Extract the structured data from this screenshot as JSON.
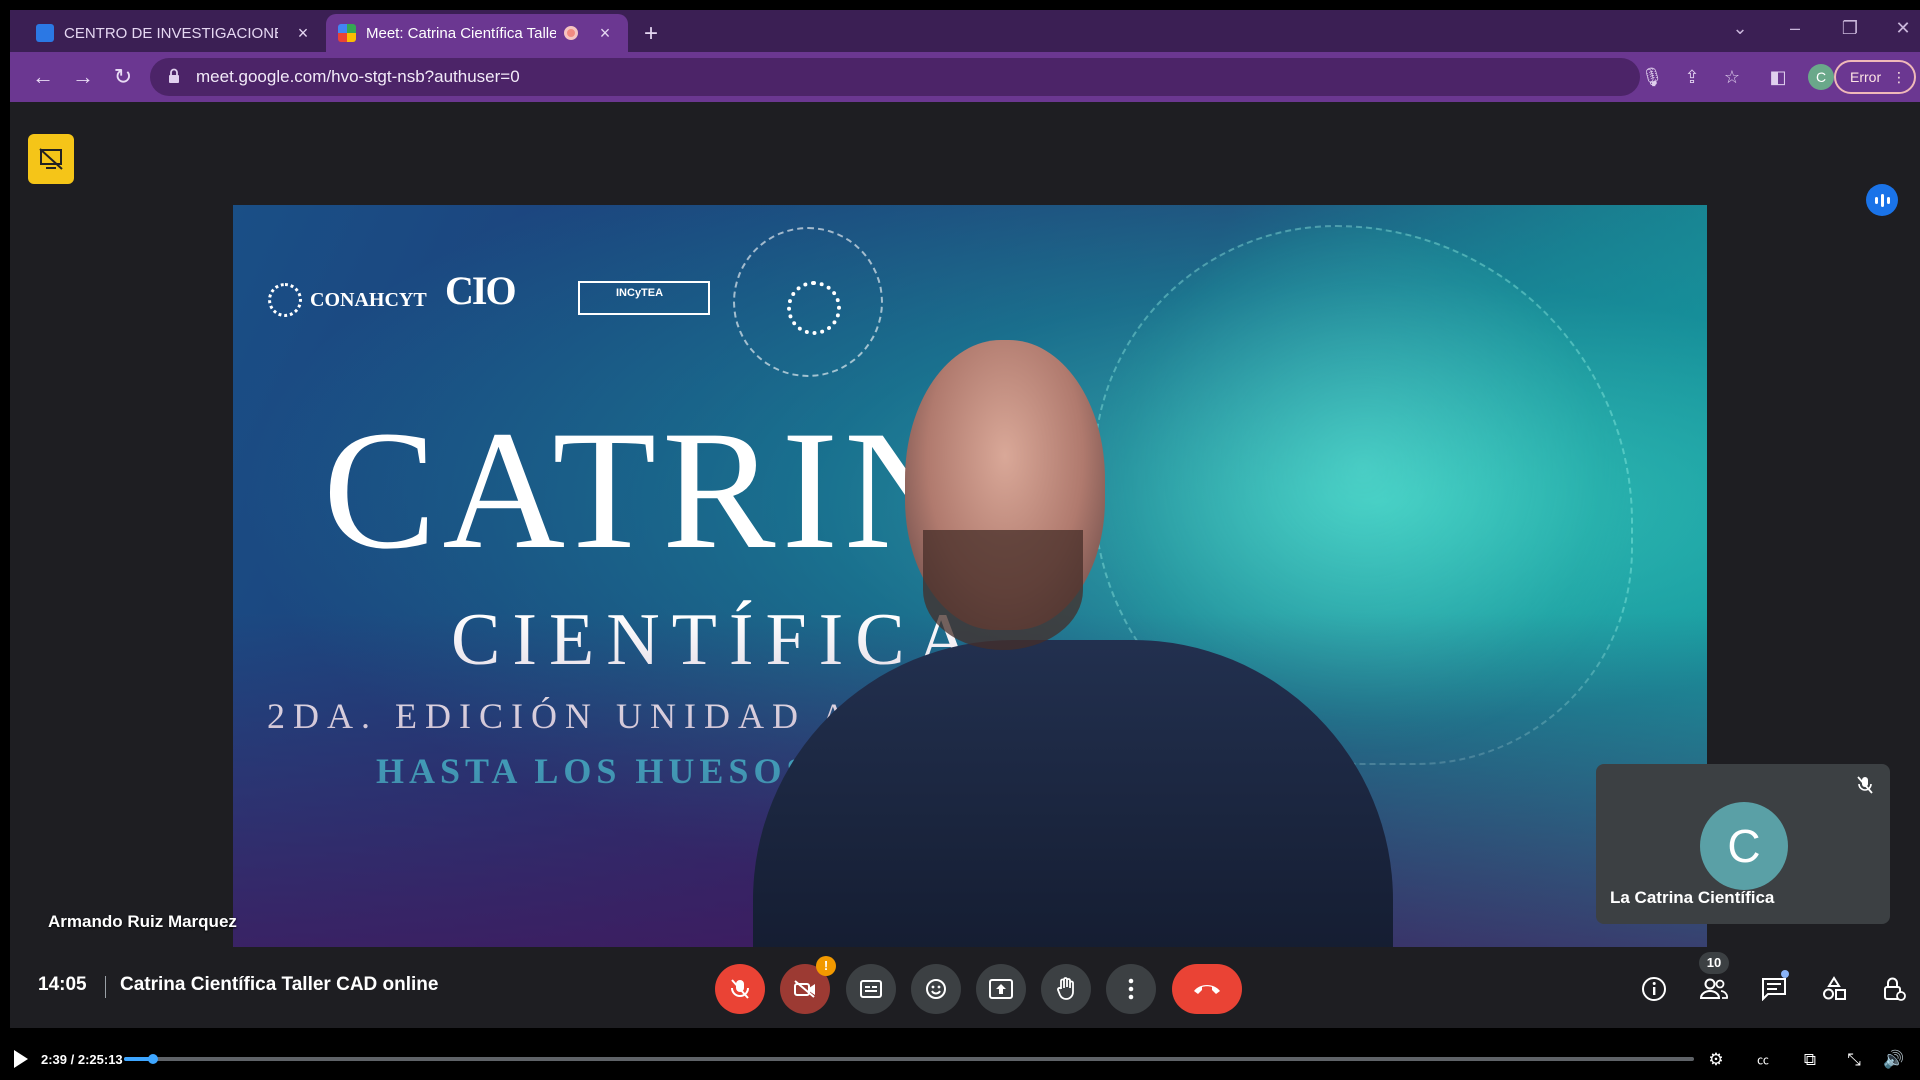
{
  "browser": {
    "tabs": [
      {
        "title": "CENTRO DE INVESTIGACIONES E",
        "close": "×"
      },
      {
        "title": "Meet: Catrina Científica Taller",
        "close": "×"
      }
    ],
    "new_tab": "+",
    "url": "meet.google.com/hvo-stgt-nsb?authuser=0",
    "profile_initial": "C",
    "error_label": "Error"
  },
  "slide": {
    "logo_conahcyt": "CONAHCYT",
    "logo_cio": "CIO",
    "logo_incytea": "INCyTEA",
    "title": "CATRINA",
    "subtitle": "CIENTÍFICA",
    "edition": "2DA. EDICIÓN UNIDAD AGUASCALIENTES",
    "tagline": "HASTA LOS HUESOS"
  },
  "meet": {
    "speaker_name": "Armando Ruiz Marquez",
    "self_initial": "C",
    "self_name": "La Catrina Científica",
    "time": "14:05",
    "meeting_title": "Catrina Científica Taller CAD online",
    "people_count": "10",
    "cam_alert": "!"
  },
  "player": {
    "time": "2:39 / 2:25:13",
    "progress": 0.0183
  },
  "colors": {
    "tabstrip": "#3b1f54",
    "toolbar": "#6b3791",
    "meet_bg": "#1e1e22",
    "danger": "#ea4335",
    "accent": "#1a73e8",
    "present_badge": "#f5c518"
  },
  "icons": [
    "back-arrow-icon",
    "forward-arrow-icon",
    "reload-icon",
    "lock-icon",
    "mic-icon",
    "share-icon",
    "star-icon",
    "sidepanel-icon",
    "menu-dots-icon",
    "mic-off-icon",
    "camera-off-icon",
    "captions-icon",
    "emoji-icon",
    "present-icon",
    "raise-hand-icon",
    "more-options-icon",
    "hangup-icon",
    "info-icon",
    "people-icon",
    "chat-icon",
    "activities-icon",
    "host-controls-icon",
    "play-icon",
    "settings-icon",
    "cc-icon",
    "miniplayer-icon",
    "fullscreen-exit-icon",
    "volume-icon"
  ]
}
